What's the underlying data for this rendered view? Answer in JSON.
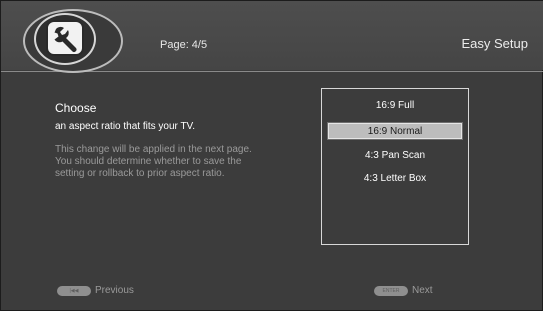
{
  "header": {
    "page_label": "Page: 4/5",
    "title": "Easy Setup",
    "logo_icon": "wrench-icon"
  },
  "main": {
    "choose_label": "Choose",
    "subtitle": "an aspect ratio that fits your TV.",
    "note_lines": [
      "This change will be applied in the next page.",
      "You should determine whether to save the",
      "setting or rollback to prior aspect ratio."
    ]
  },
  "options": {
    "items": [
      {
        "label": "16:9 Full"
      },
      {
        "label": "16:9 Normal"
      },
      {
        "label": "4:3 Pan Scan"
      },
      {
        "label": "4:3 Letter Box"
      }
    ],
    "selected": "16:9 Normal"
  },
  "footer": {
    "previous_key": "|◀◀",
    "previous_label": "Previous",
    "next_key": "ENTER",
    "next_label": "Next"
  },
  "colors": {
    "background": "#3c3c3c",
    "selected_highlight": "#bdbdbd",
    "hint_text": "#9a9a9a"
  }
}
